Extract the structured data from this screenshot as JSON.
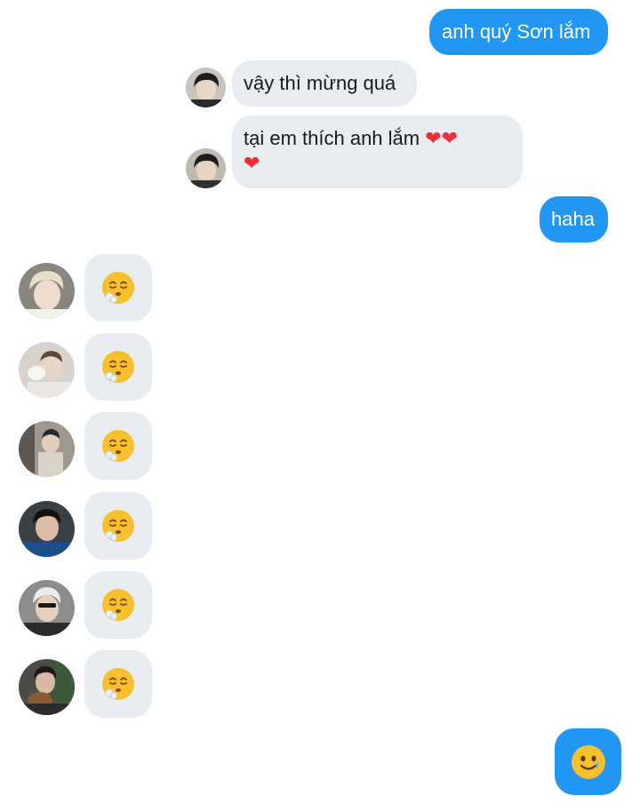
{
  "conversation": {
    "messages": [
      {
        "sender": "me",
        "text": "anh quý Sơn lắm"
      },
      {
        "sender": "contact",
        "text": "vậy thì mừng quá"
      },
      {
        "sender": "contact",
        "text": "tại em thích anh lắm",
        "hearts": "❤❤",
        "hearts_wrap": "❤"
      },
      {
        "sender": "me",
        "text": "haha"
      }
    ],
    "reactions": [
      {
        "sender": "participant-1",
        "emoji": "relieved-exhale-face-icon"
      },
      {
        "sender": "participant-2",
        "emoji": "relieved-exhale-face-icon"
      },
      {
        "sender": "participant-3",
        "emoji": "relieved-exhale-face-icon"
      },
      {
        "sender": "participant-4",
        "emoji": "relieved-exhale-face-icon"
      },
      {
        "sender": "participant-5",
        "emoji": "relieved-exhale-face-icon"
      },
      {
        "sender": "participant-6",
        "emoji": "relieved-exhale-face-icon"
      }
    ],
    "last_message": {
      "sender": "me",
      "emoji": "smiling-face-with-tear-icon"
    }
  },
  "colors": {
    "outgoing_bubble": "#2196f3",
    "incoming_bubble": "#e9ecf1",
    "heart": "#e8313b",
    "emoji_face": "#f7c02e"
  }
}
